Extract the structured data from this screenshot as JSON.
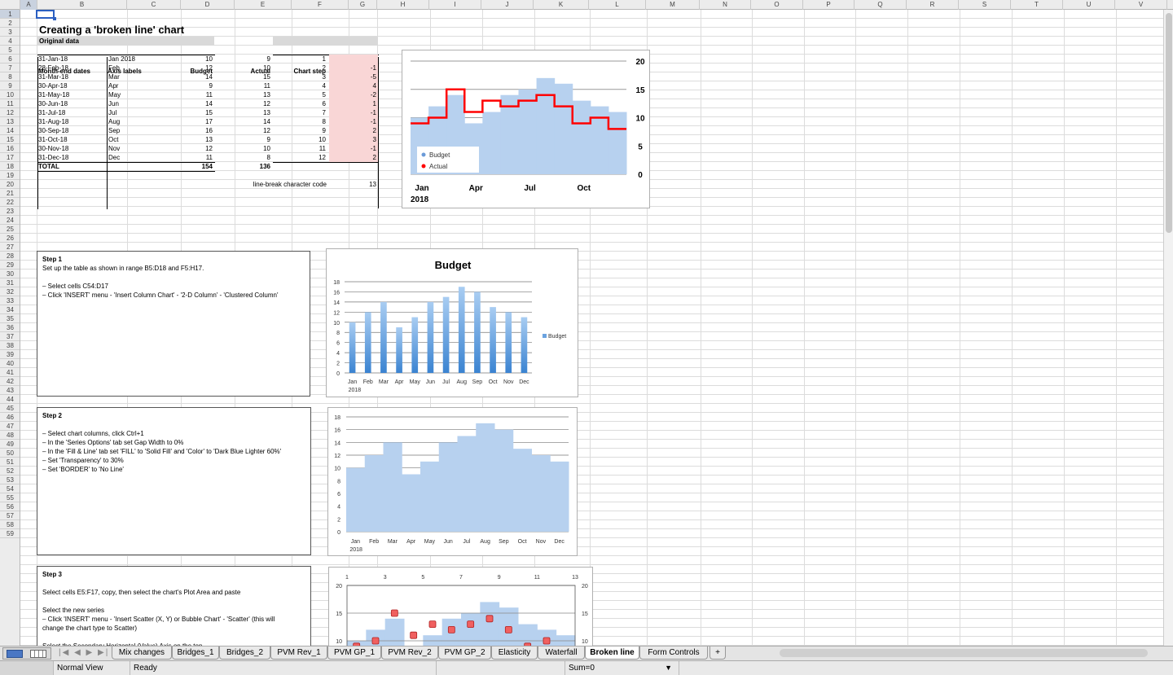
{
  "columns": [
    "A",
    "B",
    "C",
    "D",
    "E",
    "F",
    "G",
    "H",
    "I",
    "J",
    "K",
    "L",
    "M",
    "N",
    "O",
    "P",
    "Q",
    "R",
    "S",
    "T",
    "U",
    "V",
    "W"
  ],
  "rows": [
    "1",
    "2",
    "3",
    "4",
    "5",
    "6",
    "7",
    "8",
    "9",
    "10",
    "11",
    "12",
    "13",
    "14",
    "15",
    "16",
    "17",
    "18",
    "19",
    "20",
    "21",
    "22",
    "23",
    "24",
    "25",
    "26",
    "27",
    "28",
    "29",
    "30",
    "31",
    "32",
    "33",
    "34",
    "35",
    "36",
    "37",
    "38",
    "39",
    "40",
    "41",
    "42",
    "43",
    "44",
    "45",
    "46",
    "47",
    "48",
    "49",
    "50",
    "51",
    "52",
    "53",
    "54",
    "55",
    "56",
    "57",
    "58",
    "59"
  ],
  "sheet": {
    "title": "Creating a 'broken line' chart",
    "section_label": "Original data",
    "headers": {
      "month_end": "Month-end dates",
      "axis_labels": "Axis labels",
      "budget": "Budget",
      "actual": "Actual",
      "chart_step": "Chart step",
      "y_error_1": "Y error bars",
      "y_error_2": "(act)"
    },
    "table": [
      {
        "date": "31-Jan-18",
        "label": "Jan 2018",
        "budget": "10",
        "actual": "9",
        "step": "1",
        "err": ""
      },
      {
        "date": "28-Feb-18",
        "label": "Feb",
        "budget": "12",
        "actual": "10",
        "step": "2",
        "err": "-1"
      },
      {
        "date": "31-Mar-18",
        "label": "Mar",
        "budget": "14",
        "actual": "15",
        "step": "3",
        "err": "-5"
      },
      {
        "date": "30-Apr-18",
        "label": "Apr",
        "budget": "9",
        "actual": "11",
        "step": "4",
        "err": "4"
      },
      {
        "date": "31-May-18",
        "label": "May",
        "budget": "11",
        "actual": "13",
        "step": "5",
        "err": "-2"
      },
      {
        "date": "30-Jun-18",
        "label": "Jun",
        "budget": "14",
        "actual": "12",
        "step": "6",
        "err": "1"
      },
      {
        "date": "31-Jul-18",
        "label": "Jul",
        "budget": "15",
        "actual": "13",
        "step": "7",
        "err": "-1"
      },
      {
        "date": "31-Aug-18",
        "label": "Aug",
        "budget": "17",
        "actual": "14",
        "step": "8",
        "err": "-1"
      },
      {
        "date": "30-Sep-18",
        "label": "Sep",
        "budget": "16",
        "actual": "12",
        "step": "9",
        "err": "2"
      },
      {
        "date": "31-Oct-18",
        "label": "Oct",
        "budget": "13",
        "actual": "9",
        "step": "10",
        "err": "3"
      },
      {
        "date": "30-Nov-18",
        "label": "Nov",
        "budget": "12",
        "actual": "10",
        "step": "11",
        "err": "-1"
      },
      {
        "date": "31-Dec-18",
        "label": "Dec",
        "budget": "11",
        "actual": "8",
        "step": "12",
        "err": "2"
      }
    ],
    "total_label": "TOTAL",
    "total_budget": "154",
    "total_actual": "136",
    "linebreak_label": "line-break character code",
    "linebreak_value": "13"
  },
  "steps": {
    "step1": {
      "title": "Step 1",
      "lines": [
        "Set up the table as shown in range B5:D18 and F5:H17.",
        "",
        "– Select cells C54:D17",
        "– Click 'INSERT' menu - 'Insert Column Chart' - '2-D Column' - 'Clustered Column'"
      ]
    },
    "step2": {
      "title": "Step 2",
      "lines": [
        "",
        "– Select chart columns, click Ctrl+1",
        "– In the 'Series Options' tab set Gap Width to 0%",
        "– In the 'Fill & Line' tab set 'FILL' to 'Solid Fill' and 'Color' to 'Dark Blue Lighter 60%'",
        "– Set 'Transparency' to 30%",
        "– Set 'BORDER' to 'No Line'"
      ]
    },
    "step3": {
      "title": "Step 3",
      "lines": [
        "",
        "Select cells E5:F17, copy, then select the chart's Plot Area and paste",
        "",
        "Select the new series",
        "– Click 'INSERT' menu - 'Insert Scatter (X, Y) or Bubble Chart' - 'Scatter' (this will",
        "change the chart type to Scatter)",
        "",
        "Select the Secondary Horizontal (Value) Axis on the top"
      ]
    }
  },
  "chart_data": [
    {
      "type": "area",
      "categories": [
        "Jan 2018",
        "Feb",
        "Mar",
        "Apr",
        "May",
        "Jun",
        "Jul",
        "Aug",
        "Sep",
        "Oct",
        "Nov",
        "Dec"
      ],
      "series": [
        {
          "name": "Budget",
          "values": [
            10,
            12,
            14,
            9,
            11,
            14,
            15,
            17,
            16,
            13,
            12,
            11
          ]
        },
        {
          "name": "Actual",
          "values": [
            9,
            10,
            15,
            11,
            13,
            12,
            13,
            14,
            12,
            9,
            10,
            8
          ]
        }
      ],
      "x_tick_labels": [
        "Jan",
        "Apr",
        "Jul",
        "Oct"
      ],
      "x_tick_sublabel": "2018",
      "y_ticks": [
        "0",
        "5",
        "10",
        "15",
        "20"
      ],
      "ylim": [
        0,
        20
      ],
      "legend_position": "bottom-left",
      "colors": {
        "budget": "#b7d1ef",
        "actual": "#ff0000"
      }
    },
    {
      "type": "bar",
      "title": "Budget",
      "categories": [
        "Jan",
        "Feb",
        "Mar",
        "Apr",
        "May",
        "Jun",
        "Jul",
        "Aug",
        "Sep",
        "Oct",
        "Nov",
        "Dec"
      ],
      "x_tick_sublabel": "2018",
      "series": [
        {
          "name": "Budget",
          "values": [
            10,
            12,
            14,
            9,
            11,
            14,
            15,
            17,
            16,
            13,
            12,
            11
          ]
        }
      ],
      "y_ticks": [
        "0",
        "2",
        "4",
        "6",
        "8",
        "10",
        "12",
        "14",
        "16",
        "18"
      ],
      "ylim": [
        0,
        18
      ],
      "legend_position": "right"
    },
    {
      "type": "bar",
      "categories": [
        "Jan",
        "Feb",
        "Mar",
        "Apr",
        "May",
        "Jun",
        "Jul",
        "Aug",
        "Sep",
        "Oct",
        "Nov",
        "Dec"
      ],
      "x_tick_sublabel": "2018",
      "series": [
        {
          "values": [
            10,
            12,
            14,
            9,
            11,
            14,
            15,
            17,
            16,
            13,
            12,
            11
          ]
        }
      ],
      "y_ticks": [
        "0",
        "2",
        "4",
        "6",
        "8",
        "10",
        "12",
        "14",
        "16",
        "18"
      ],
      "ylim": [
        0,
        18
      ]
    },
    {
      "type": "scatter",
      "top_x_ticks": [
        "1",
        "3",
        "5",
        "7",
        "9",
        "11",
        "13"
      ],
      "y_ticks": [
        "10",
        "15",
        "20"
      ],
      "y_ticks_right": [
        "10",
        "15",
        "20"
      ],
      "ylim": [
        10,
        20
      ],
      "bars": [
        10,
        12,
        14,
        9,
        11,
        14,
        15,
        17,
        16,
        13,
        12,
        11
      ],
      "points_x": [
        1,
        2,
        3,
        4,
        5,
        6,
        7,
        8,
        9,
        10,
        11,
        12
      ],
      "points_y": [
        9,
        10,
        15,
        11,
        13,
        12,
        13,
        14,
        12,
        9,
        10,
        8
      ]
    }
  ],
  "tabs": [
    "Mix changes",
    "Bridges_1",
    "Bridges_2",
    "PVM Rev_1",
    "PVM GP_1",
    "PVM Rev_2",
    "PVM GP_2",
    "Elasticity",
    "Waterfall",
    "Broken line",
    "Form Controls"
  ],
  "active_tab": "Broken line",
  "status": {
    "view": "Normal View",
    "state": "Ready",
    "sum": "Sum=0"
  }
}
